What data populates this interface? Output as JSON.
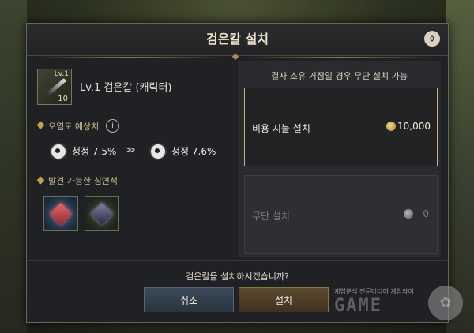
{
  "dialog": {
    "title": "검은칼 설치",
    "help_icon": "pot-icon"
  },
  "item": {
    "level_badge": "Lv.1",
    "count": "10",
    "name": "Lv.1 검은칼 (캐릭터)"
  },
  "pollution": {
    "section_title": "오염도 예상치",
    "info_label": "i",
    "from_text": "청정 7.5%",
    "arrow": "≫",
    "to_text": "청정 7.6%"
  },
  "gems": {
    "section_title": "발견 가능한 심연석"
  },
  "install_options": {
    "header": "결사 소유 거점일 경우 무단 설치 가능",
    "paid_label": "비용 지불 설치",
    "paid_cost": "10,000",
    "free_label": "무단 설치",
    "free_cost": "0"
  },
  "footer": {
    "question": "검은칼을 설치하시겠습니까?",
    "cancel_label": "취소",
    "confirm_label": "설치"
  },
  "watermark": {
    "tagline": "게임분석 전문미디어 게임와이",
    "logo": "GAME"
  },
  "colors": {
    "accent_gold": "#c9b078",
    "cancel_button": "#3c4a59",
    "confirm_button": "#5b4a30"
  }
}
